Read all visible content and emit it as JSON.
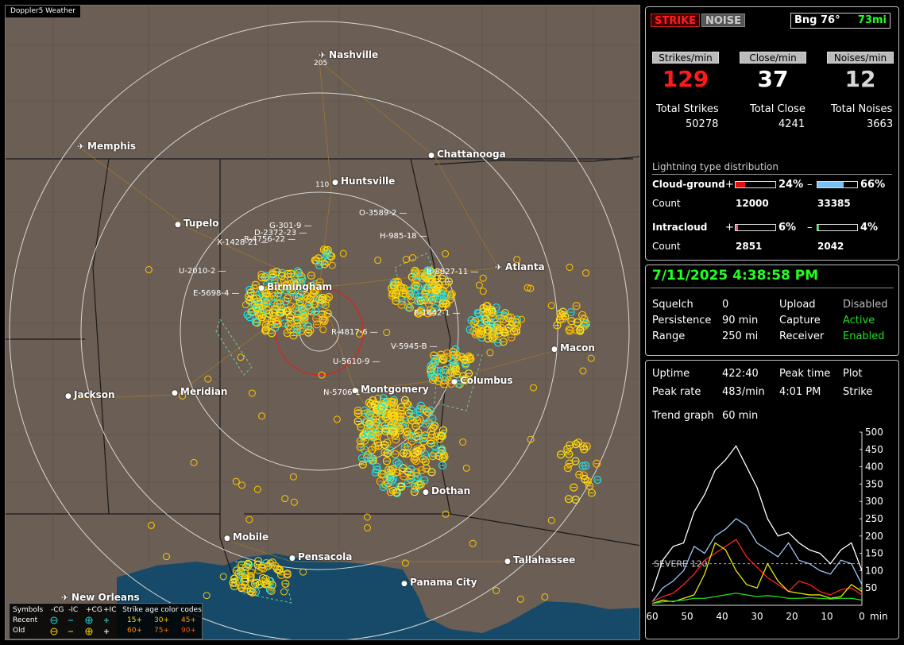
{
  "app_title": "Doppler5 Weather",
  "cities": [
    {
      "name": "Nashville",
      "icon": "airport"
    },
    {
      "name": "Memphis",
      "icon": "airport"
    },
    {
      "name": "Chattanooga",
      "icon": "city"
    },
    {
      "name": "Huntsville",
      "icon": "city"
    },
    {
      "name": "Tupelo",
      "icon": "city"
    },
    {
      "name": "Atlanta",
      "icon": "airport"
    },
    {
      "name": "Birmingham",
      "icon": "city"
    },
    {
      "name": "Macon",
      "icon": "city"
    },
    {
      "name": "Columbus",
      "icon": "city"
    },
    {
      "name": "Montgomery",
      "icon": "city"
    },
    {
      "name": "Jackson",
      "icon": "city"
    },
    {
      "name": "Meridian",
      "icon": "city"
    },
    {
      "name": "Dothan",
      "icon": "city"
    },
    {
      "name": "Mobile",
      "icon": "city"
    },
    {
      "name": "Pensacola",
      "icon": "city"
    },
    {
      "name": "Tallahassee",
      "icon": "city"
    },
    {
      "name": "Panama City",
      "icon": "city"
    },
    {
      "name": "New Orleans",
      "icon": "airport"
    }
  ],
  "range_labels": [
    "205",
    "110"
  ],
  "storm_labels": [
    "G-301-9",
    "D-2372-23",
    "R-4756-22",
    "X-1428-21",
    "O-3589-2",
    "H-985-18",
    "U-2010-2",
    "E-5698-4",
    "B-8827-11",
    "E-1642-1",
    "R-4817-6",
    "V-5945-B",
    "U-5610-9",
    "N-5706-1"
  ],
  "legend": {
    "symbols_label": "Symbols",
    "recent_label": "Recent",
    "old_label": "Old",
    "types": [
      "-CG",
      "-IC",
      "+CG",
      "+IC"
    ],
    "age_title": "Strike age color codes",
    "age_recent": [
      "15+",
      "30+",
      "45+"
    ],
    "age_old": [
      "60+",
      "75+",
      "90+"
    ]
  },
  "status": {
    "strike_btn": "STRIKE",
    "noise_btn": "NOISE",
    "bearing_label": "Bng 76°",
    "bearing_dist": "73mi",
    "strikes_min_label": "Strikes/min",
    "close_min_label": "Close/min",
    "noises_min_label": "Noises/min",
    "strikes_min": "129",
    "close_min": "37",
    "noises_min": "12",
    "total_strikes_label": "Total Strikes",
    "total_close_label": "Total Close",
    "total_noises_label": "Total Noises",
    "total_strikes": "50278",
    "total_close": "4241",
    "total_noises": "3663",
    "dist_title": "Lightning type distribution",
    "cg_label": "Cloud-ground",
    "ic_label": "Intracloud",
    "count_label": "Count",
    "plus": "+",
    "minus": "–",
    "cg_pos_pct": "24%",
    "cg_neg_pct": "66%",
    "cg_pos_count": "12000",
    "cg_neg_count": "33385",
    "ic_pos_pct": "6%",
    "ic_neg_pct": "4%",
    "ic_pos_count": "2851",
    "ic_neg_count": "2042",
    "cg_pos_frac": 0.24,
    "cg_neg_frac": 0.66,
    "ic_pos_frac": 0.06,
    "ic_neg_frac": 0.04
  },
  "settings": {
    "datetime": "7/11/2025 4:38:58 PM",
    "squelch_label": "Squelch",
    "squelch": "0",
    "persistence_label": "Persistence",
    "persistence": "90 min",
    "range_label": "Range",
    "range": "250 mi",
    "upload_label": "Upload",
    "upload": "Disabled",
    "capture_label": "Capture",
    "capture": "Active",
    "receiver_label": "Receiver",
    "receiver": "Enabled"
  },
  "stats": {
    "uptime_label": "Uptime",
    "uptime": "422:40",
    "peak_time_label": "Peak time",
    "peak_time": "4:01 PM",
    "plot_label": "Plot",
    "plot": "Strike",
    "peak_rate_label": "Peak rate",
    "peak_rate": "483/min",
    "trend_label": "Trend graph",
    "trend": "60 min",
    "severe_label": "SEVERE 120"
  },
  "colors": {
    "strike_red": "#ff2020",
    "active_green": "#22dd22",
    "accent_green": "#22ff22",
    "strike_yellow": "#ffe000",
    "strike_cyan": "#22e0e0"
  },
  "chart_data": {
    "type": "line",
    "title": "",
    "xlabel": "min",
    "ylabel": "",
    "xlim": [
      60,
      0
    ],
    "ylim": [
      0,
      500
    ],
    "x_ticks": [
      "60",
      "50",
      "40",
      "30",
      "20",
      "10",
      "0"
    ],
    "y_ticks": [
      "500",
      "450",
      "400",
      "350",
      "300",
      "250",
      "200",
      "150",
      "100",
      "50"
    ],
    "severe_threshold": 120,
    "x": [
      60,
      57,
      54,
      51,
      48,
      45,
      42,
      39,
      36,
      33,
      30,
      27,
      24,
      21,
      18,
      15,
      12,
      9,
      6,
      3,
      0
    ],
    "series": [
      {
        "color": "#ffffff",
        "values": [
          40,
          130,
          170,
          180,
          270,
          320,
          390,
          420,
          460,
          400,
          340,
          250,
          200,
          210,
          180,
          160,
          150,
          120,
          160,
          180,
          100
        ]
      },
      {
        "color": "#9fc4f2",
        "values": [
          10,
          50,
          70,
          100,
          170,
          150,
          200,
          220,
          250,
          230,
          180,
          160,
          140,
          180,
          130,
          120,
          100,
          90,
          130,
          120,
          60
        ]
      },
      {
        "color": "#ff2020",
        "values": [
          10,
          25,
          35,
          60,
          90,
          130,
          150,
          170,
          190,
          140,
          110,
          80,
          60,
          40,
          70,
          60,
          40,
          30,
          45,
          50,
          30
        ]
      },
      {
        "color": "#e8e800",
        "values": [
          5,
          15,
          10,
          20,
          30,
          90,
          180,
          160,
          100,
          60,
          50,
          120,
          70,
          40,
          35,
          30,
          30,
          20,
          25,
          60,
          40
        ]
      },
      {
        "color": "#22dd22",
        "values": [
          5,
          10,
          12,
          15,
          20,
          20,
          25,
          30,
          35,
          30,
          25,
          28,
          25,
          20,
          20,
          22,
          20,
          18,
          20,
          20,
          15
        ]
      }
    ]
  }
}
